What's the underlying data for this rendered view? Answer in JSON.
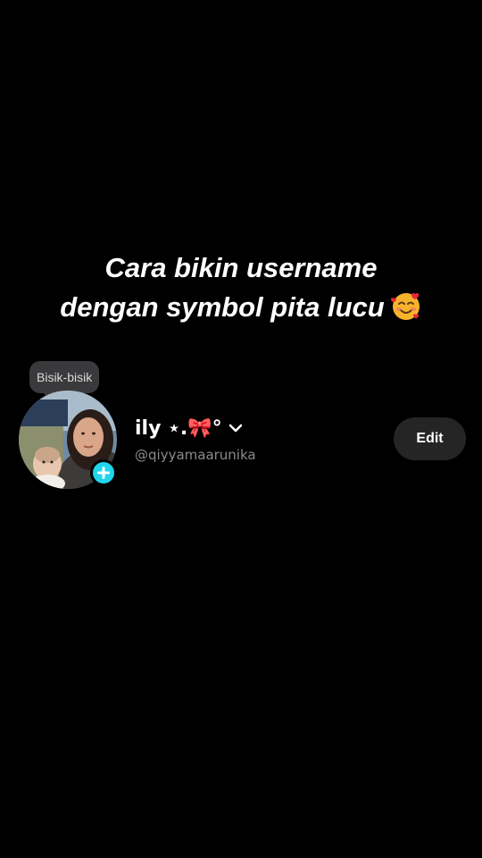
{
  "caption": {
    "line1": "Cara bikin username",
    "line2": "dengan symbol pita lucu",
    "emoji": "smiling-face-with-hearts-icon"
  },
  "profile": {
    "note_bubble": "Bisik-bisik",
    "display_name": "ily ⋆.🎀°",
    "username": "@qiyyamaarunika",
    "edit_label": "Edit",
    "avatar": "profile-photo",
    "add_icon": "plus-icon",
    "dropdown_icon": "chevron-down-icon"
  },
  "colors": {
    "background": "#000000",
    "add_badge": "#20d5ec",
    "edit_button": "#252525",
    "note_bubble": "#3a3a3c",
    "username": "#8a8a8a"
  }
}
